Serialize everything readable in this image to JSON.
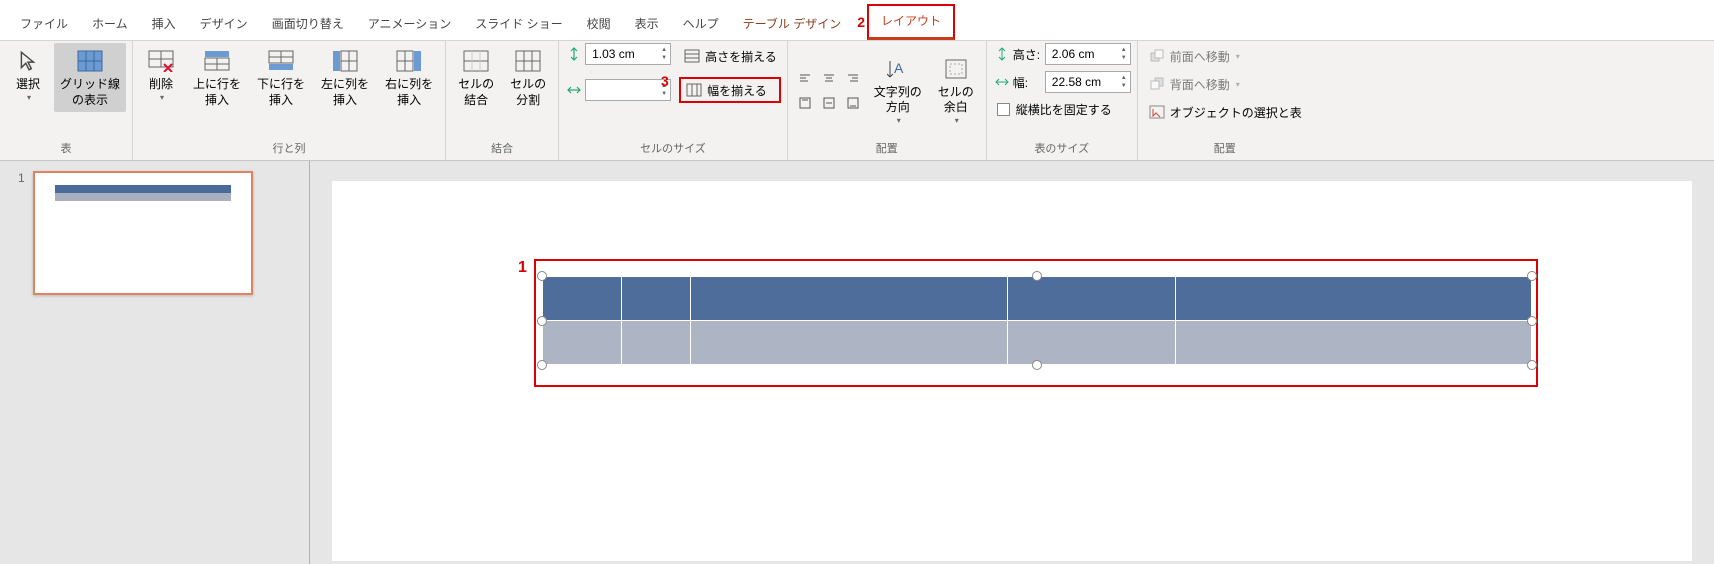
{
  "tabs": {
    "file": "ファイル",
    "home": "ホーム",
    "insert": "挿入",
    "design": "デザイン",
    "transitions": "画面切り替え",
    "animations": "アニメーション",
    "slideshow": "スライド ショー",
    "review": "校閲",
    "view": "表示",
    "help": "ヘルプ",
    "table_design": "テーブル デザイン",
    "layout": "レイアウト"
  },
  "annotations": {
    "a1": "1",
    "a2": "2",
    "a3": "3"
  },
  "ribbon": {
    "table": {
      "select": "選択",
      "gridlines": "グリッド線\nの表示",
      "label": "表"
    },
    "rows_cols": {
      "delete": "削除",
      "insert_row_above": "上に行を\n挿入",
      "insert_row_below": "下に行を\n挿入",
      "insert_col_left": "左に列を\n挿入",
      "insert_col_right": "右に列を\n挿入",
      "label": "行と列"
    },
    "merge": {
      "merge_cells": "セルの\n結合",
      "split_cells": "セルの\n分割",
      "label": "結合"
    },
    "cell_size": {
      "height_value": "1.03 cm",
      "width_value": "",
      "distribute_rows": "高さを揃える",
      "distribute_cols": "幅を揃える",
      "label": "セルのサイズ"
    },
    "alignment": {
      "text_direction": "文字列の\n方向",
      "cell_margins": "セルの\n余白",
      "label": "配置"
    },
    "table_size": {
      "height_label": "高さ:",
      "height_value": "2.06 cm",
      "width_label": "幅:",
      "width_value": "22.58 cm",
      "lock_aspect": "縦横比を固定する",
      "label": "表のサイズ"
    },
    "arrange": {
      "bring_forward": "前面へ移動",
      "send_backward": "背面へ移動",
      "selection_pane": "オブジェクトの選択と表",
      "label": "配置"
    }
  },
  "thumbs": {
    "n1": "1"
  }
}
